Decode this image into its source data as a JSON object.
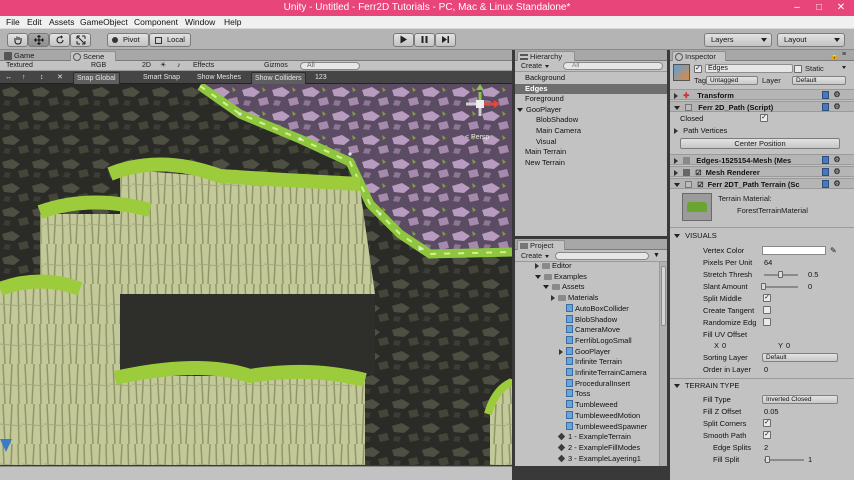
{
  "window": {
    "title": "Unity - Untitled - Ferr2D Tutorials - PC, Mac & Linux Standalone*",
    "accent_color": "#e8457a"
  },
  "menubar": [
    "File",
    "Edit",
    "Assets",
    "GameObject",
    "Component",
    "Window",
    "Help"
  ],
  "toolbar": {
    "pivot": "Pivot",
    "local": "Local",
    "layers": "Layers",
    "layout": "Layout"
  },
  "scene": {
    "tabs": [
      "Game",
      "Scene"
    ],
    "options": {
      "shading": "Textured",
      "render": "RGB",
      "mode2d": "2D",
      "effects": "Effects",
      "gizmos": "Gizmos",
      "search": "All"
    },
    "toolbar2": {
      "snap_global": "Snap Global",
      "smart_snap": "Smart Snap",
      "show_meshes": "Show Meshes",
      "show_colliders": "Show Colliders",
      "number": "123"
    },
    "gizmo_label": "< Persp"
  },
  "hierarchy": {
    "tab": "Hierarchy",
    "create": "Create",
    "search": "All",
    "items": [
      {
        "label": "Background",
        "indent": 0,
        "selected": false
      },
      {
        "label": "Edges",
        "indent": 0,
        "selected": true
      },
      {
        "label": "Foreground",
        "indent": 0,
        "selected": false
      },
      {
        "label": "GooPlayer",
        "indent": 0,
        "selected": false,
        "expanded": true
      },
      {
        "label": "BlobShadow",
        "indent": 1,
        "selected": false
      },
      {
        "label": "Main Camera",
        "indent": 1,
        "selected": false
      },
      {
        "label": "Visual",
        "indent": 1,
        "selected": false
      },
      {
        "label": "Main Terrain",
        "indent": 0,
        "selected": false
      },
      {
        "label": "New Terrain",
        "indent": 0,
        "selected": false
      }
    ]
  },
  "project": {
    "tab": "Project",
    "create": "Create",
    "items": [
      {
        "label": "Editor",
        "indent": 2,
        "type": "folder",
        "arrow": "right"
      },
      {
        "label": "Examples",
        "indent": 2,
        "type": "folder",
        "arrow": "down"
      },
      {
        "label": "Assets",
        "indent": 3,
        "type": "folder",
        "arrow": "down"
      },
      {
        "label": "Materials",
        "indent": 4,
        "type": "folder",
        "arrow": "right"
      },
      {
        "label": "AutoBoxCollider",
        "indent": 5,
        "type": "script"
      },
      {
        "label": "BlobShadow",
        "indent": 5,
        "type": "script"
      },
      {
        "label": "CameraMove",
        "indent": 5,
        "type": "script"
      },
      {
        "label": "FerrlibLogoSmall",
        "indent": 5,
        "type": "script"
      },
      {
        "label": "GooPlayer",
        "indent": 5,
        "type": "script",
        "arrow": "right"
      },
      {
        "label": "Infinite Terrain",
        "indent": 5,
        "type": "script"
      },
      {
        "label": "InfiniteTerrainCamera",
        "indent": 5,
        "type": "script"
      },
      {
        "label": "ProceduralInsert",
        "indent": 5,
        "type": "script"
      },
      {
        "label": "Toss",
        "indent": 5,
        "type": "script"
      },
      {
        "label": "Tumbleweed",
        "indent": 5,
        "type": "script"
      },
      {
        "label": "TumbleweedMotion",
        "indent": 5,
        "type": "script"
      },
      {
        "label": "TumbleweedSpawner",
        "indent": 5,
        "type": "script"
      },
      {
        "label": "1 - ExampleTerrain",
        "indent": 4,
        "type": "scene"
      },
      {
        "label": "2 - ExampleFillModes",
        "indent": 4,
        "type": "scene"
      },
      {
        "label": "3 - ExampleLayering1",
        "indent": 4,
        "type": "scene"
      }
    ]
  },
  "inspector": {
    "tab": "Inspector",
    "object_name": "Edges",
    "static_label": "Static",
    "tag_label": "Tag",
    "tag_value": "Untagged",
    "layer_label": "Layer",
    "layer_value": "Default",
    "transform": "Transform",
    "path_script": "Ferr 2D_Path (Script)",
    "closed_label": "Closed",
    "path_vertices": "Path Vertices",
    "center_position": "Center Position",
    "mesh_filter": "Edges-1525154-Mesh (Mes",
    "mesh_renderer": "Mesh Renderer",
    "terrain_script": "Ferr 2DT_Path Terrain (Sc",
    "terrain_material_label": "Terrain Material:",
    "terrain_material_value": "ForestTerrainMaterial",
    "visuals_header": "VISUALS",
    "vertex_color": "Vertex Color",
    "pixels_per_unit": "Pixels Per Unit",
    "pixels_per_unit_value": "64",
    "stretch_threshold": "Stretch Thresh",
    "stretch_threshold_value": "0.5",
    "slant_amount": "Slant Amount",
    "slant_amount_value": "0",
    "split_middle": "Split Middle",
    "create_tangents": "Create Tangent",
    "randomize_edge": "Randomize Edg",
    "fill_uv_offset": "Fill UV Offset",
    "uv_x_label": "X",
    "uv_x_value": "0",
    "uv_y_label": "Y",
    "uv_y_value": "0",
    "sorting_layer": "Sorting Layer",
    "sorting_layer_value": "Default",
    "order_in_layer": "Order in Layer",
    "order_in_layer_value": "0",
    "terrain_type_header": "TERRAIN TYPE",
    "fill_type": "Fill Type",
    "fill_type_value": "Inverted Closed",
    "fill_z_offset": "Fill Z Offset",
    "fill_z_offset_value": "0.05",
    "split_corners": "Split Corners",
    "smooth_path": "Smooth Path",
    "edge_splits": "Edge Splits",
    "edge_splits_value": "2",
    "fill_split": "Fill Split",
    "fill_split_value": "1",
    "stretch_threshold_level": 0.5,
    "slant_amount_level": 0.0,
    "fill_split_level": 0.1
  }
}
